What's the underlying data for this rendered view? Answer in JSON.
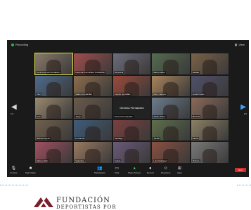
{
  "window": {
    "title": "Recording",
    "view_label": "View"
  },
  "pager": {
    "left_page": "1/2",
    "right_page": "2/2"
  },
  "participants": [
    {
      "name": "Lucia Lorenzo Fundación",
      "color": "#8a7a6a"
    },
    {
      "name": "Facundo Fernández Fundación",
      "color": "#a24d4d"
    },
    {
      "name": "Florencia",
      "color": "#6d6d7c"
    },
    {
      "name": "Maria Isabel",
      "color": "#556b4f"
    },
    {
      "name": "Natalia",
      "color": "#7a6248"
    },
    {
      "name": "Yani",
      "color": "#4d6b8c"
    },
    {
      "name": "Martin Fernández",
      "color": "#8c6d4d"
    },
    {
      "name": "Camilo González",
      "color": "#9c4a3a"
    },
    {
      "name": "Moni Carrera",
      "color": "#a8845c"
    },
    {
      "name": "Lucas Flores",
      "color": "#50506a"
    },
    {
      "name": "Lino",
      "color": "#9a8a70"
    },
    {
      "name": "Jorge",
      "color": "#6b5b4b"
    },
    {
      "name": "Gemma Fernandez",
      "color": "#222222"
    },
    {
      "name": "Adrian Perez",
      "color": "#6c7c8c"
    },
    {
      "name": "Marcela",
      "color": "#8a6a5a"
    },
    {
      "name": "Belinda Lopez",
      "color": "#70604c"
    },
    {
      "name": "Fernando",
      "color": "#3e5c7a"
    },
    {
      "name": "Santiago",
      "color": "#7c3f3f"
    },
    {
      "name": "Tomás",
      "color": "#5e6e4a"
    },
    {
      "name": "Karina",
      "color": "#8c8064"
    },
    {
      "name": "Marcos Ruiz",
      "color": "#a05060"
    },
    {
      "name": "Valentina",
      "color": "#9a7a60"
    },
    {
      "name": "Julieta",
      "color": "#6a5a7a"
    },
    {
      "name": "Luis Rodriguez",
      "color": "#8a5040"
    },
    {
      "name": "Victoria",
      "color": "#7a7a7a"
    }
  ],
  "toolbar": {
    "mute": "Unmute",
    "video": "Start Video",
    "participants": "Participants",
    "chat": "Chat",
    "share": "Share Screen",
    "record": "Record",
    "reactions": "Reactions",
    "apps": "Apps",
    "end": "End"
  },
  "foundation": {
    "name": "FUNDACIÓN",
    "subtitle": "DEPORTISTAS POR"
  }
}
